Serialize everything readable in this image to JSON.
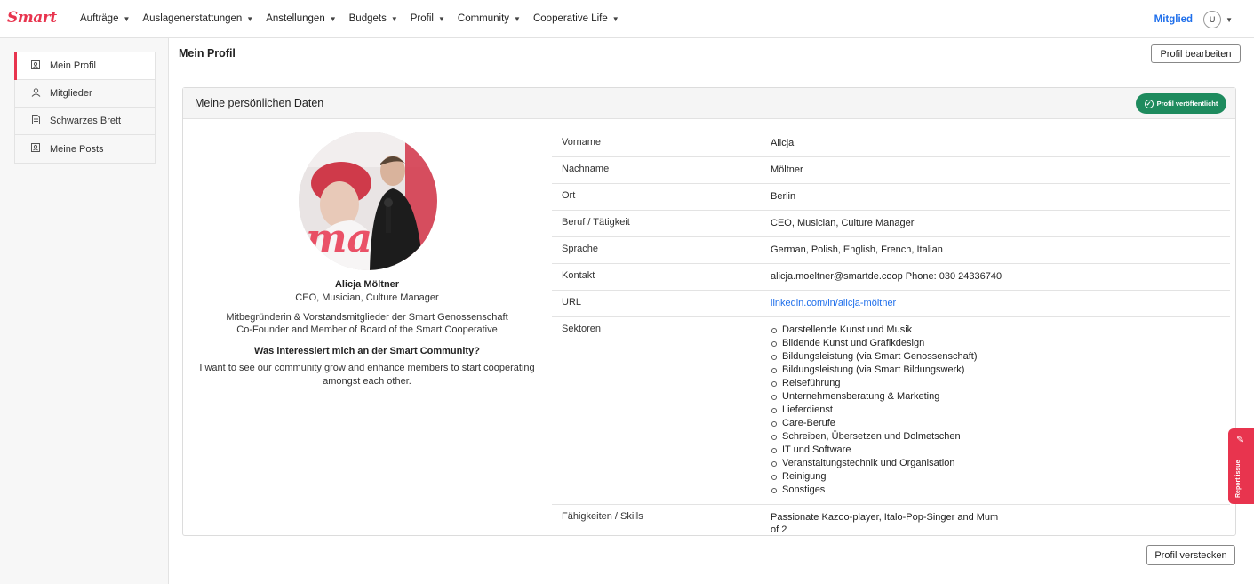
{
  "brand": {
    "logo_text": "Smart",
    "accent": "#e8344e",
    "link_color": "#1f6feb",
    "success": "#1e8b5e"
  },
  "nav": [
    {
      "label": "Aufträge"
    },
    {
      "label": "Auslagenerstattungen"
    },
    {
      "label": "Anstellungen"
    },
    {
      "label": "Budgets"
    },
    {
      "label": "Profil"
    },
    {
      "label": "Community"
    },
    {
      "label": "Cooperative Life"
    }
  ],
  "user": {
    "role_label": "Mitglied",
    "avatar_initial": "U"
  },
  "sidebar": {
    "items": [
      {
        "label": "Mein Profil",
        "icon": "profile-card-icon",
        "active": true
      },
      {
        "label": "Mitglieder",
        "icon": "users-icon",
        "active": false
      },
      {
        "label": "Schwarzes Brett",
        "icon": "document-icon",
        "active": false
      },
      {
        "label": "Meine Posts",
        "icon": "profile-card-icon",
        "active": false
      }
    ]
  },
  "header": {
    "title": "Mein Profil",
    "edit_label": "Profil bearbeiten"
  },
  "card": {
    "title": "Meine persönlichen Daten",
    "badge": "Profil veröffentlicht"
  },
  "profile": {
    "name": "Alicja Möltner",
    "role": "CEO, Musician, Culture Manager",
    "bio_line1": "Mitbegründerin & Vorstandsmitglieder der Smart Genossenschaft",
    "bio_line2": "Co-Founder and Member of Board of the Smart Cooperative",
    "question": "Was interessiert mich an der Smart Community?",
    "answer": "I want to see our community grow and enhance members to start cooperating amongst each other."
  },
  "details": {
    "vorname": {
      "key": "Vorname",
      "value": "Alicja"
    },
    "nachname": {
      "key": "Nachname",
      "value": "Möltner"
    },
    "ort": {
      "key": "Ort",
      "value": "Berlin"
    },
    "beruf": {
      "key": "Beruf / Tätigkeit",
      "value": "CEO, Musician, Culture Manager"
    },
    "sprache": {
      "key": "Sprache",
      "value": "German, Polish, English, French, Italian"
    },
    "kontakt": {
      "key": "Kontakt",
      "value": "alicja.moeltner@smartde.coop Phone: 030 24336740"
    },
    "url": {
      "key": "URL",
      "value": "linkedin.com/in/alicja-möltner"
    },
    "sektoren": {
      "key": "Sektoren",
      "values": [
        "Darstellende Kunst und Musik",
        "Bildende Kunst und Grafikdesign",
        "Bildungsleistung (via Smart Genossenschaft)",
        "Bildungsleistung (via Smart Bildungswerk)",
        "Reiseführung",
        "Unternehmensberatung & Marketing",
        "Lieferdienst",
        "Care-Berufe",
        "Schreiben, Übersetzen und Dolmetschen",
        "IT und Software",
        "Veranstaltungstechnik und Organisation",
        "Reinigung",
        "Sonstiges"
      ]
    },
    "skills": {
      "key": "Fähigkeiten / Skills",
      "value": "Passionate Kazoo-player, Italo-Pop-Singer and Mum of 2"
    }
  },
  "footer": {
    "hide_label": "Profil verstecken"
  },
  "report": {
    "label": "Report issue",
    "icon": "pencil-icon"
  }
}
